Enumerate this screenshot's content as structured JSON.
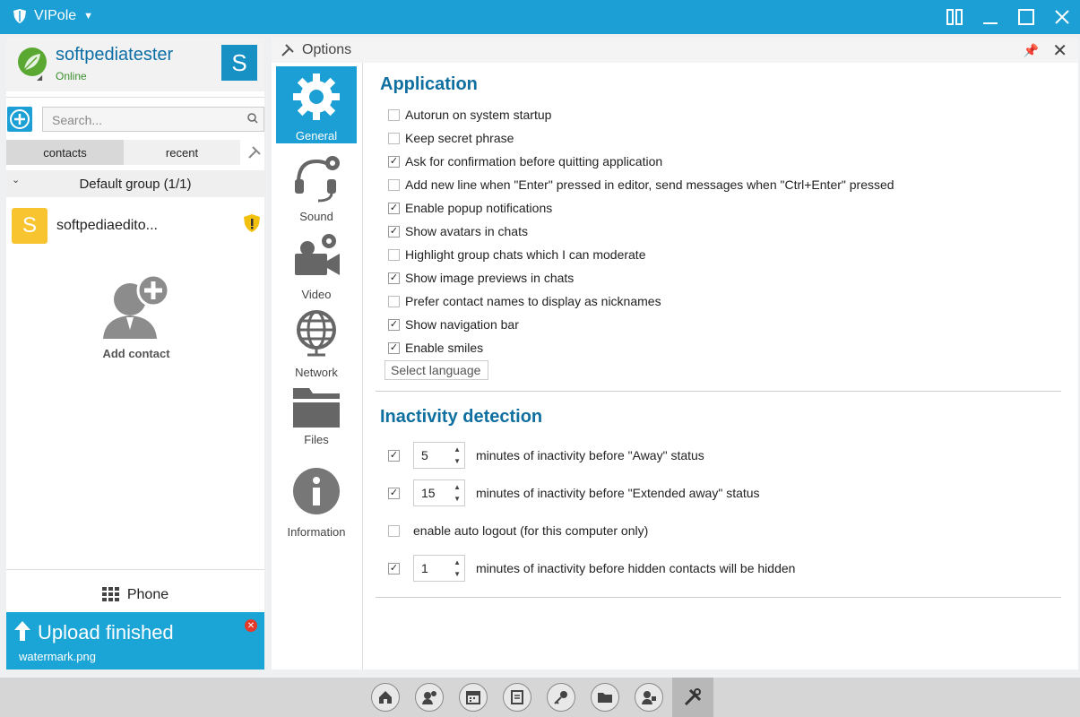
{
  "titlebar": {
    "app_name": "VIPole"
  },
  "profile": {
    "name": "softpediatester",
    "status": "Online",
    "avatar_letter": "S"
  },
  "search": {
    "placeholder": "Search..."
  },
  "tabs": {
    "contacts": "contacts",
    "recent": "recent"
  },
  "group": {
    "label": "Default group (1/1)"
  },
  "contact": {
    "name": "softpediaedito...",
    "avatar_letter": "S"
  },
  "add_contact": {
    "label": "Add contact"
  },
  "phone": {
    "label": "Phone"
  },
  "upload": {
    "title": "Upload finished",
    "file": "watermark.png"
  },
  "options": {
    "header": "Options",
    "nav": [
      "General",
      "Sound",
      "Video",
      "Network",
      "Files",
      "Information"
    ],
    "application": {
      "title": "Application",
      "items": [
        {
          "label": "Autorun on system startup",
          "checked": false
        },
        {
          "label": "Keep secret phrase",
          "checked": false
        },
        {
          "label": "Ask for confirmation before quitting application",
          "checked": true
        },
        {
          "label": "Add new line when \"Enter\" pressed in editor, send messages when \"Ctrl+Enter\" pressed",
          "checked": false
        },
        {
          "label": "Enable popup notifications",
          "checked": true
        },
        {
          "label": "Show avatars in chats",
          "checked": true
        },
        {
          "label": "Highlight group chats which I can moderate",
          "checked": false
        },
        {
          "label": "Show image previews in chats",
          "checked": true
        },
        {
          "label": "Prefer contact names to display as nicknames",
          "checked": false
        },
        {
          "label": "Show navigation bar",
          "checked": true
        },
        {
          "label": "Enable smiles",
          "checked": true
        }
      ],
      "language_button": "Select language"
    },
    "inactivity": {
      "title": "Inactivity detection",
      "away": {
        "checked": true,
        "value": "5",
        "label": "minutes of inactivity before \"Away\" status"
      },
      "extended": {
        "checked": true,
        "value": "15",
        "label": "minutes of inactivity before \"Extended away\" status"
      },
      "logout": {
        "checked": false,
        "label": "enable auto logout (for this computer only)"
      },
      "hidden": {
        "checked": true,
        "value": "1",
        "label": "minutes of inactivity before hidden contacts will be hidden"
      }
    }
  },
  "colors": {
    "accent": "#1b9fd4",
    "heading": "#0f6fa0",
    "online": "#3a8f2c",
    "contact_avatar": "#f8c531"
  }
}
